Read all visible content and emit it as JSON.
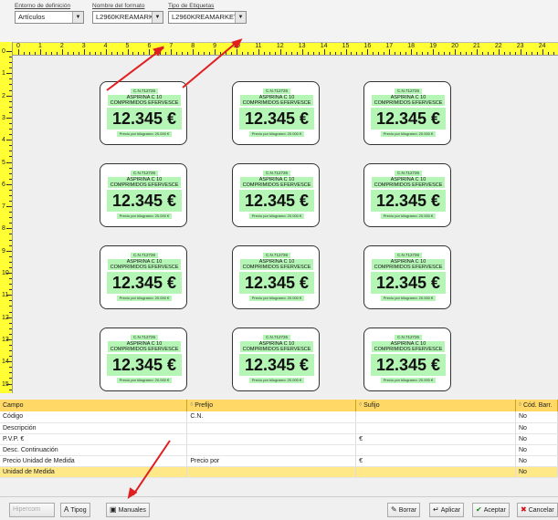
{
  "toolbar": {
    "entorno_label": "Entorno de definición",
    "entorno_value": "Artículos",
    "formato_label": "Nombre del formato",
    "formato_value": "L2960KREAMARKET",
    "tipo_label": "Tipo de Etiquetas",
    "tipo_value": "L2960KREAMARKET"
  },
  "ruler": {
    "top": [
      "0",
      "1",
      "2",
      "3",
      "4",
      "5",
      "6",
      "7",
      "8",
      "9",
      "10",
      "11",
      "12",
      "13",
      "14",
      "15",
      "16",
      "17",
      "18",
      "19",
      "20",
      "21",
      "22",
      "23",
      "24"
    ],
    "left": [
      "0",
      "1",
      "2",
      "3",
      "4",
      "5",
      "6",
      "7",
      "8",
      "9",
      "10",
      "11",
      "12",
      "13",
      "14",
      "15"
    ]
  },
  "labels": [
    {
      "cn": "C.N.712726",
      "name": "ASPIRINA C 10\nCOMPRIMIDOS EFERVESCE",
      "price": "12.345 €",
      "ppk": "Precio por kilogramo: 20.000 €"
    },
    {
      "cn": "C.N.712726",
      "name": "ASPIRINA C 10\nCOMPRIMIDOS EFERVESCE",
      "price": "12.345 €",
      "ppk": "Precio por kilogramo: 20.000 €"
    },
    {
      "cn": "C.N.712726",
      "name": "ASPIRINA C 10\nCOMPRIMIDOS EFERVESCE",
      "price": "12.345 €",
      "ppk": "Precio por kilogramo: 20.000 €"
    }
  ],
  "table": {
    "headers": [
      "Campo",
      "Prefijo",
      "Sufijo",
      "Cód. Barr."
    ],
    "rows": [
      [
        "Código",
        "C.N.",
        "",
        "No"
      ],
      [
        "Descripción",
        "",
        "",
        "No"
      ],
      [
        "P.V.P. €",
        "",
        "€",
        "No"
      ],
      [
        "Desc. Continuación",
        "",
        "",
        "No"
      ],
      [
        "Precio Unidad de Medida",
        "Precio por",
        "€",
        "No"
      ],
      [
        "Unidad de Medida",
        "",
        "",
        "No"
      ]
    ]
  },
  "buttons": {
    "b1": "Hipercom",
    "b2": "Tipog",
    "b3": "Manuales",
    "borrar": "Borrar",
    "aplicar": "Aplicar",
    "aceptar": "Aceptar",
    "cancelar": "Cancelar"
  },
  "colors": {
    "ruler": "#ffff33",
    "label_fill": "#b5f5b5",
    "table_header": "#ffd866",
    "arrow": "#e02020"
  }
}
